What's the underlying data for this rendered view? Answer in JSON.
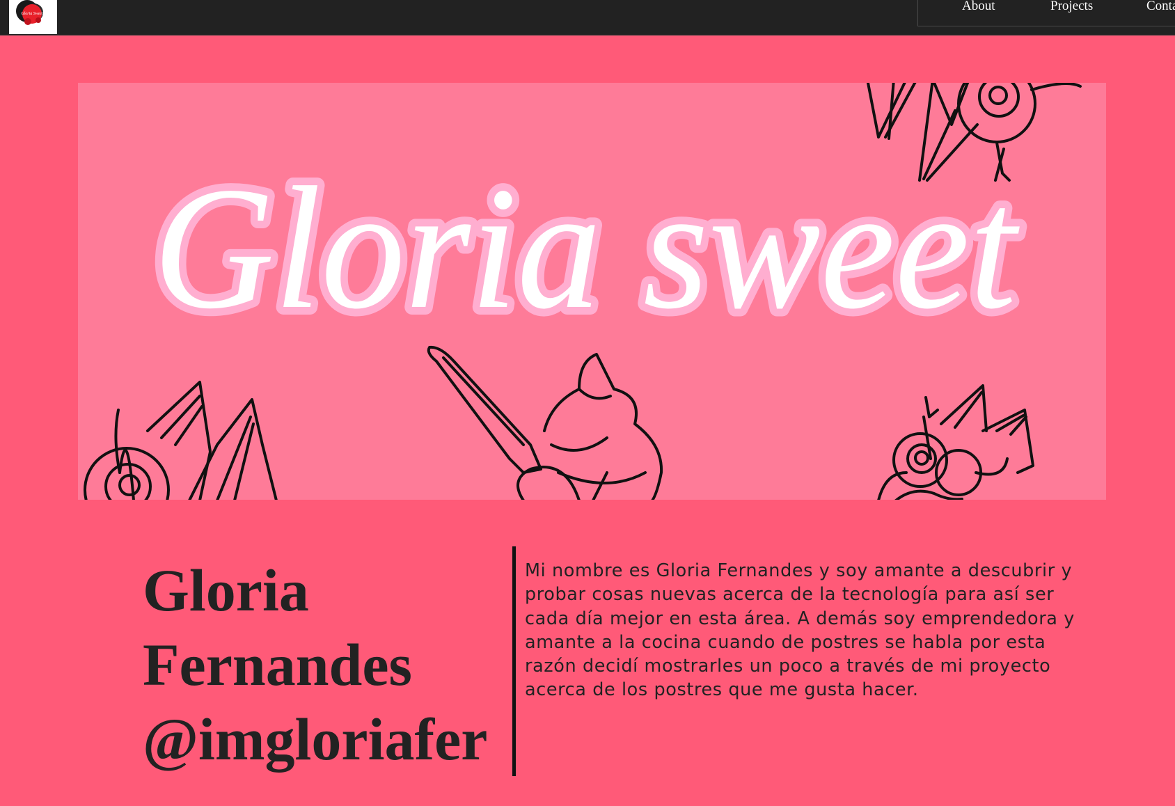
{
  "nav": {
    "logo_text": "Gloria Sweet",
    "links": [
      "About",
      "Projects",
      "Contact"
    ]
  },
  "hero": {
    "banner_text": "Gloria sweet"
  },
  "profile": {
    "first_name": "Gloria",
    "last_name": "Fernandes",
    "handle": "@imgloriafer",
    "bio": "Mi nombre es Gloria Fernandes y soy amante a descubrir y probar cosas nuevas acerca de la tecnología para así ser cada día mejor en esta área. A demás soy emprendedora y amante a la cocina cuando de postres se habla por esta razón decidí mostrarles un poco a través de mi proyecto acerca de los postres que me gusta hacer."
  },
  "colors": {
    "page_background": "#ff5a78",
    "navbar": "#222222",
    "banner": "#fe7b98",
    "banner_text_outline": "#ffaed0"
  }
}
